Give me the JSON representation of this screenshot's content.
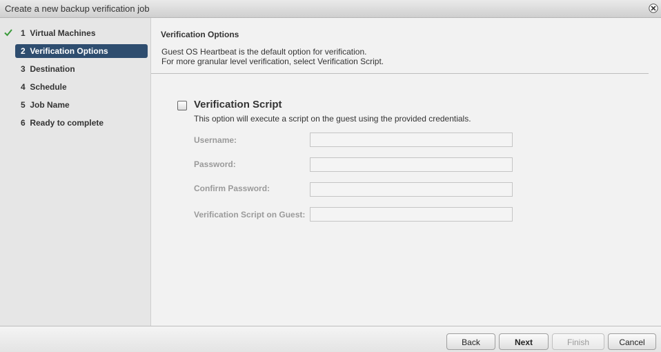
{
  "window": {
    "title": "Create a new backup verification job",
    "close_icon": "close-circle-icon"
  },
  "sidebar": {
    "steps": [
      {
        "label": "1  Virtual Machines",
        "completed": true,
        "active": false
      },
      {
        "label": "2  Verification Options",
        "completed": false,
        "active": true
      },
      {
        "label": "3  Destination",
        "completed": false,
        "active": false
      },
      {
        "label": "4  Schedule",
        "completed": false,
        "active": false
      },
      {
        "label": "5  Job Name",
        "completed": false,
        "active": false
      },
      {
        "label": "6  Ready to complete",
        "completed": false,
        "active": false
      }
    ],
    "completed_icon": "checkmark-icon",
    "active_color": "#2e4d6f",
    "check_color": "#3a9a3a"
  },
  "main": {
    "section_title": "Verification Options",
    "description_line1": "Guest OS Heartbeat is the default option for verification.",
    "description_line2": "For more granular level verification, select Verification Script.",
    "option": {
      "title": "Verification Script",
      "description": "This option will execute a script on the guest using the provided credentials.",
      "checked": false
    },
    "fields": [
      {
        "label": "Username:",
        "value": "",
        "enabled": false
      },
      {
        "label": "Password:",
        "value": "",
        "enabled": false
      },
      {
        "label": "Confirm Password:",
        "value": "",
        "enabled": false
      },
      {
        "label": "Verification Script on Guest:",
        "value": "",
        "enabled": false
      }
    ]
  },
  "footer": {
    "back_label": "Back",
    "next_label": "Next",
    "finish_label": "Finish",
    "cancel_label": "Cancel",
    "finish_enabled": false
  }
}
